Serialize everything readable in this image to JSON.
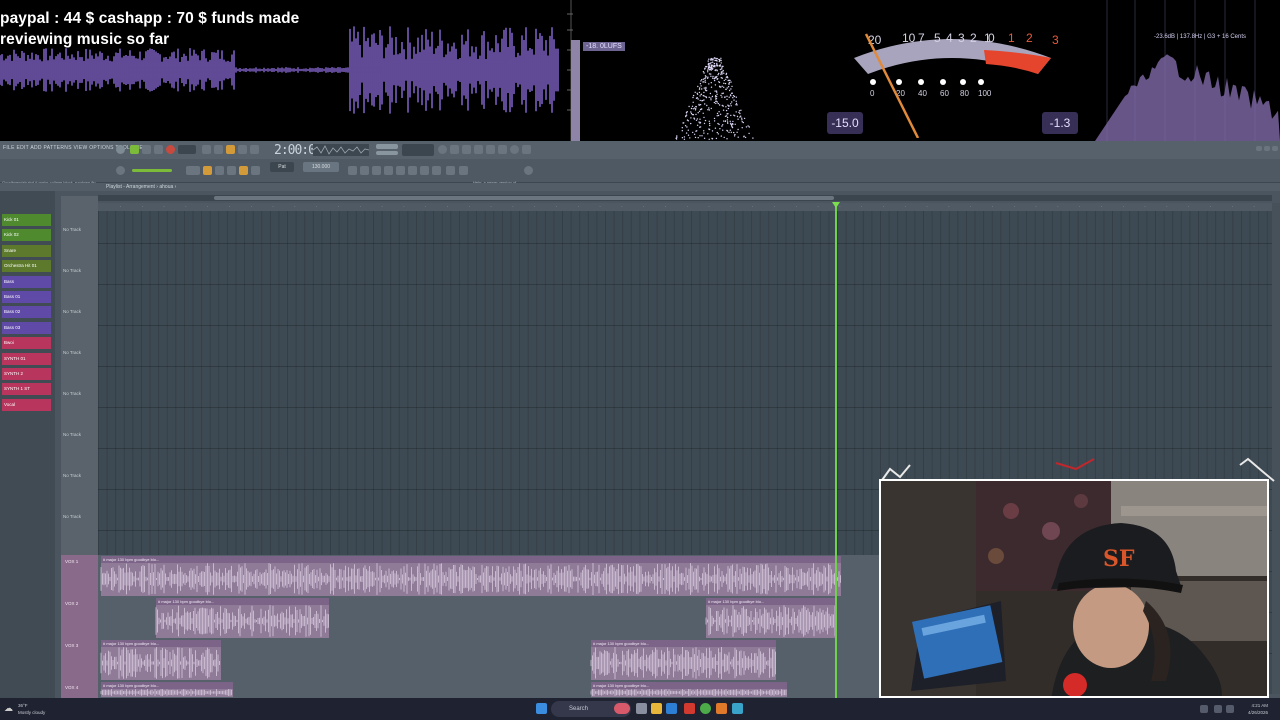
{
  "overlay": {
    "funds_line1": "paypal : 44 $  cashapp : 70 $ funds made",
    "funds_line2": "reviewing music so far",
    "lufs_label": "-18. 0LUFS",
    "vu_scale_top": [
      "20",
      "10",
      "7",
      "5",
      "4",
      "3",
      "2",
      "1",
      "0",
      "1",
      "2",
      "3"
    ],
    "vu_scale_bottom": [
      "0",
      "20",
      "40",
      "60",
      "80",
      "100"
    ],
    "vu_left_readout": "-15.0",
    "vu_right_readout": "-1.3",
    "spectrum_readout": "-23.6dB | 137.8Hz | G3 + 16 Cents",
    "accent_purple": "#8a6ad6",
    "meter_red": "#e4452c"
  },
  "fl": {
    "menu": "FILE  EDIT  ADD  PATTERNS  VIEW  OPTIONS  TOOLS  HELP",
    "time": "2:00:07",
    "pattern": "Pat",
    "tempo": "130.000",
    "project_line1": "Goodbyemizkutzd  # major collage block_rundown.flp",
    "project_line2": "(HKDVCK)",
    "hint_line1": "Help: a newer version of",
    "hint_line2": "FL Studio is available",
    "playlist_title": "Playlist - Arrangement  ›  ahoua  ›",
    "channels": [
      {
        "label": "Kick 01",
        "color": "#4f8a2e"
      },
      {
        "label": "Kick 02",
        "color": "#4f8a2e"
      },
      {
        "label": "Snare",
        "color": "#5d7a2c"
      },
      {
        "label": "Orchestra Hit 01",
        "color": "#5d7a2c"
      },
      {
        "label": "Bass",
        "color": "#5f4aa8"
      },
      {
        "label": "Bass 01",
        "color": "#5f4aa8"
      },
      {
        "label": "Bass 02",
        "color": "#5f4aa8"
      },
      {
        "label": "Bass 03",
        "color": "#5f4aa8"
      },
      {
        "label": "Bwoi",
        "color": "#b8365e"
      },
      {
        "label": "SYNTH 01",
        "color": "#b8365e"
      },
      {
        "label": "SYNTH 2",
        "color": "#b8365e"
      },
      {
        "label": "SYNTH 1 ST",
        "color": "#b8365e"
      },
      {
        "label": "Vocal",
        "color": "#b8365e"
      }
    ],
    "empty_track_label": "No Track",
    "audio_track_labels": [
      "VOX 1",
      "VOX 2",
      "VOX 3",
      "VOX 4"
    ],
    "clip_name": "# major 130 bpm goodbye blo..."
  },
  "taskbar": {
    "search": "Search",
    "weather_line1": "36°F",
    "weather_line2": "Mostly cloudy",
    "clock_line1": "4:21 AM",
    "clock_line2": "4/26/2026"
  }
}
